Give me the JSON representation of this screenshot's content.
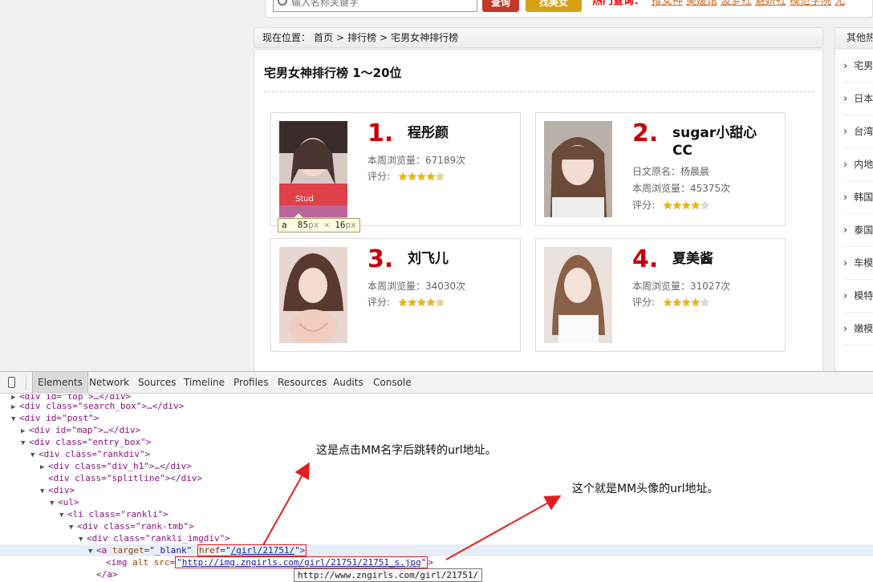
{
  "site": {
    "search_placeholder": "输入名称关键字",
    "search_button": "查询",
    "beauty_button": "找美女",
    "hot_label": "热门查询：",
    "hot_links": [
      "推女神",
      "美媛馆",
      "波萝社",
      "魅妍社",
      "模范学院",
      "尤"
    ],
    "breadcrumb": {
      "prefix": "现在位置：",
      "items": [
        "首页",
        "排行榜",
        "宅男女神排行榜"
      ],
      "sep": ">"
    },
    "title": "宅男女神排行榜 1～20位",
    "sidebar": {
      "title": "其他热",
      "items": [
        "宅男",
        "日本",
        "台湾",
        "内地",
        "韩国",
        "泰国",
        "车模",
        "模特",
        "嫩模"
      ]
    },
    "ranks": [
      {
        "rank": "1.",
        "name": "程彤颜",
        "original_name": "",
        "views": "本周浏览量：67189次",
        "rating_label": "评分:",
        "rating": 4.5
      },
      {
        "rank": "2.",
        "name": "sugar小甜心CC",
        "original_name": "日文原名：杨晨晨",
        "views": "本周浏览量：45375次",
        "rating_label": "评分:",
        "rating": 4
      },
      {
        "rank": "3.",
        "name": "刘飞儿",
        "original_name": "",
        "views": "本周浏览量：34030次",
        "rating_label": "评分:",
        "rating": 4.5
      },
      {
        "rank": "4.",
        "name": "夏美酱",
        "original_name": "",
        "views": "本周浏览量：31027次",
        "rating_label": "评分:",
        "rating": 4
      }
    ],
    "inspect_tooltip": {
      "tag": "a",
      "width": "85",
      "height": "16",
      "unit": "px",
      "times": "×"
    }
  },
  "devtools": {
    "tabs": [
      "Elements",
      "Network",
      "Sources",
      "Timeline",
      "Profiles",
      "Resources",
      "Audits",
      "Console"
    ],
    "active_tab": "Elements",
    "tree": [
      {
        "text": "<div id=\"top\">…</div>"
      },
      {
        "text": "<div class=\"search_box\">…</div>"
      },
      {
        "text": "<div id=\"post\">"
      },
      {
        "text": "<div id=\"map\">…</div>"
      },
      {
        "text": "<div class=\"entry_box\">"
      },
      {
        "text": "<div class=\"rankdiv\">"
      },
      {
        "text": "<div class=\"div_h1\">…</div>"
      },
      {
        "text": "<div class=\"splitline\"></div>"
      },
      {
        "text": "<div>"
      },
      {
        "text": "<ul>"
      },
      {
        "text": "<li class=\"rankli\">"
      },
      {
        "text": "<div class=\"rank-tmb\">"
      },
      {
        "text": "<div class=\"rankli_imgdiv\">"
      },
      {
        "text": "<a target=\"_blank\" href=\"/girl/21751/\">"
      },
      {
        "text": "<img alt src=\"http://img.zngirls.com/girl/21751/21751_s.jpg\">"
      },
      {
        "text": "</a>"
      }
    ],
    "href_value": "/girl/21751/",
    "src_value": "http://img.zngirls.com/girl/21751/21751_s.jpg",
    "url_tooltip": "http://www.zngirls.com/girl/21751/"
  },
  "annotations": {
    "note1": "这是点击MM名字后跳转的url地址。",
    "note2": "这个就是MM头像的url地址。",
    "arrow_color": "#e02020"
  }
}
